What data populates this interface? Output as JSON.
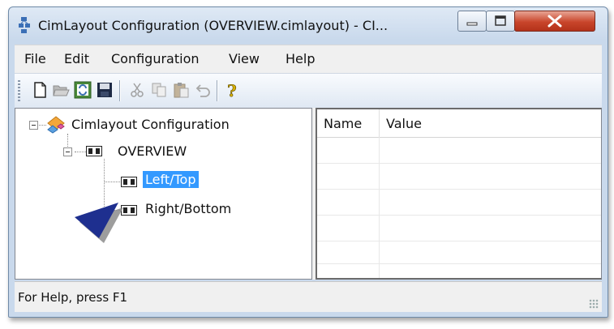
{
  "window": {
    "title": "CimLayout Configuration (OVERVIEW.cimlayout) - CI...",
    "app_icon": "cimlayout-app-icon",
    "controls": {
      "minimize_icon": "minimize-icon",
      "maximize_icon": "maximize-icon",
      "close_icon": "close-icon"
    }
  },
  "menubar": {
    "items": [
      "File",
      "Edit",
      "Configuration",
      "View",
      "Help"
    ]
  },
  "toolbar": {
    "buttons": [
      "new-icon",
      "open-icon",
      "refresh-icon",
      "save-icon",
      "cut-icon",
      "copy-icon",
      "paste-icon",
      "undo-icon",
      "about-icon"
    ]
  },
  "tree": {
    "root": {
      "label": "Cimlayout Configuration",
      "icon": "configuration-icon",
      "expanded": true
    },
    "child": {
      "label": "OVERVIEW",
      "icon": "layout-icon",
      "expanded": true
    },
    "leaves": [
      {
        "label": "Left/Top",
        "icon": "layout-icon",
        "selected": true
      },
      {
        "label": "Right/Bottom",
        "icon": "layout-icon",
        "selected": false
      }
    ]
  },
  "properties": {
    "columns": [
      "Name",
      "Value"
    ],
    "rows": []
  },
  "status": {
    "text": "For Help, press F1"
  },
  "annotation": {
    "arrow_color": "#1e2f8f",
    "shadow_color": "#8c8c8c"
  }
}
